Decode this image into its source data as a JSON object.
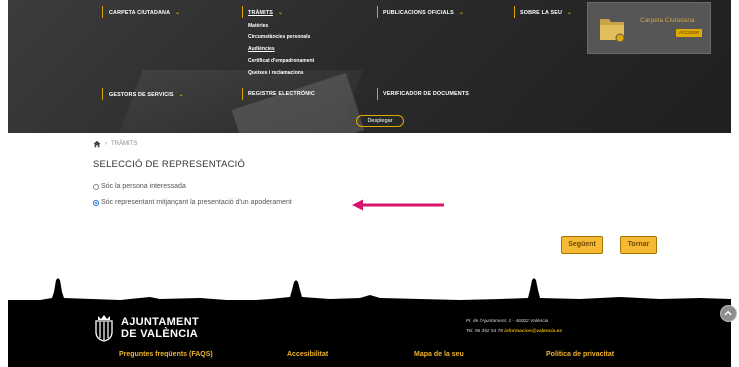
{
  "header": {
    "menu": [
      {
        "label": "CARPETA CIUTADANA"
      },
      {
        "label": "TRÀMITS"
      },
      {
        "label": "PUBLICACIONS OFICIALS"
      },
      {
        "label": "SOBRE LA SEU"
      },
      {
        "label": "GESTORS DE SERVICIS"
      },
      {
        "label": "REGISTRE ELECTRÒNIC"
      },
      {
        "label": "VERIFICADOR DE DOCUMENTS"
      }
    ],
    "submenu": [
      "Matèries",
      "Circumstàncies personals",
      "Audiències",
      "Certificat d'empadronament",
      "Queixes i reclamacions"
    ],
    "desplegar": "Desplegar",
    "carpeta_title": "Carpeta Ciutadana",
    "carpeta_btn": "ACCEDIR"
  },
  "breadcrumb": {
    "current": "TRÀMITS"
  },
  "page": {
    "title": "SELECCIÓ DE REPRESENTACIÓ",
    "options": [
      {
        "label": "Sóc la persona interessada",
        "checked": false
      },
      {
        "label": "Sóc representant mitjançant la presentació d'un apoderament",
        "checked": true
      }
    ],
    "next_button": "Següent",
    "back_button": "Tornar"
  },
  "footer": {
    "logo_line1": "AJUNTAMENT",
    "logo_line2": "DE VALÈNCIA",
    "address": "Pl. de l'Ajuntament, 1 - 46002 València",
    "phone": "Tel. 96 352 54 78",
    "email": "informacion@valencia.es",
    "links": [
      "Preguntes freqüents (FAQS)",
      "Accesibilitat",
      "Mapa de la seu",
      "Política de privacitat"
    ]
  },
  "colors": {
    "accent": "#f5b934",
    "arrow": "#d9156b",
    "radio": "#1a6fd8"
  }
}
